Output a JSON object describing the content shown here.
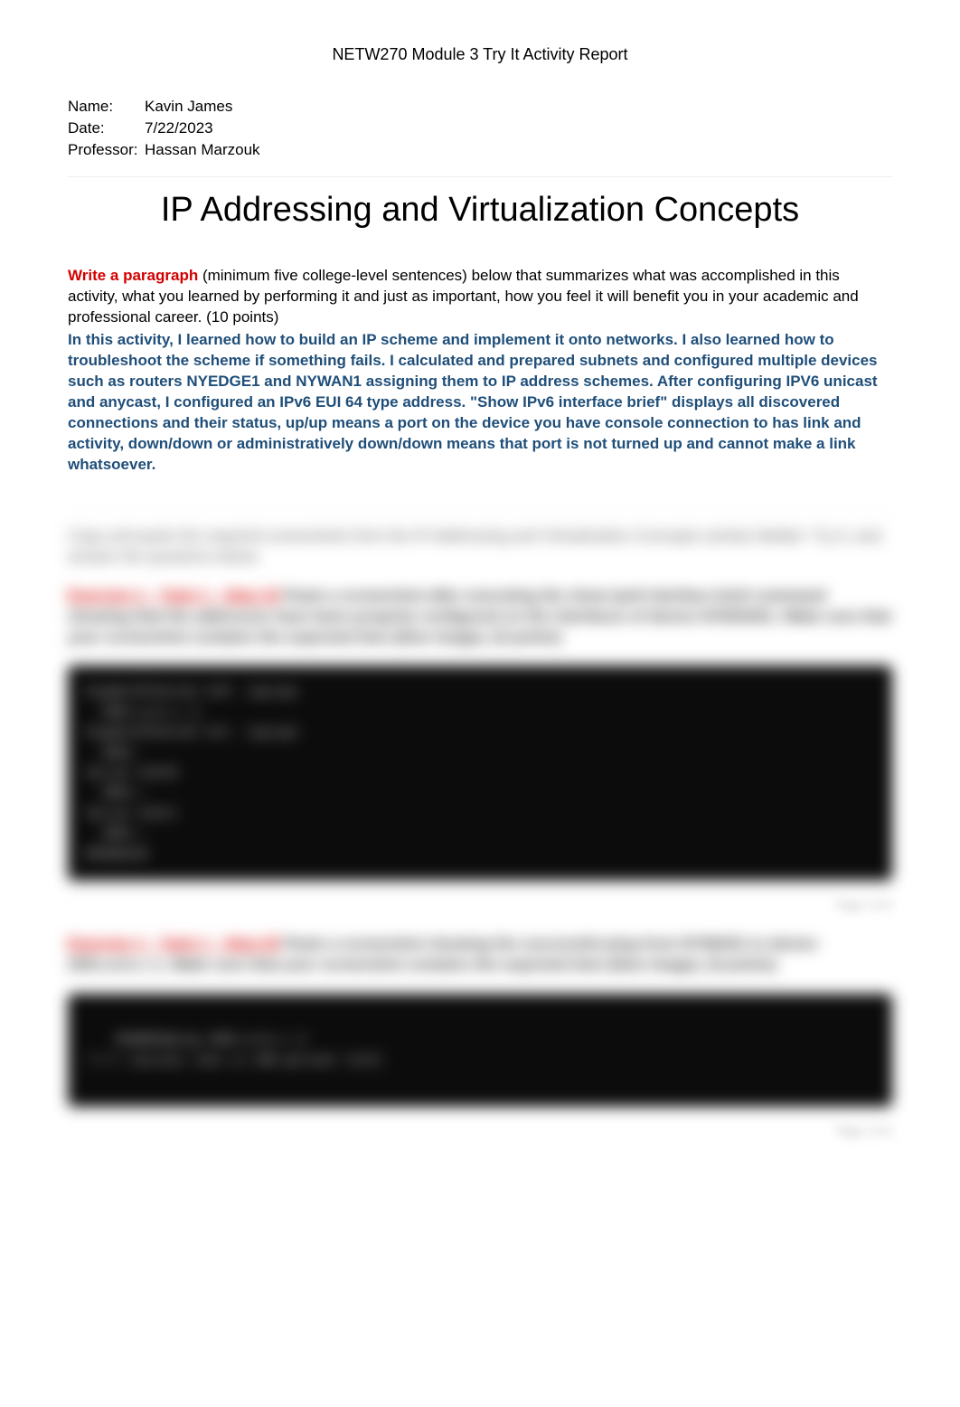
{
  "header": {
    "course_title": "NETW270 Module 3 Try It Activity Report"
  },
  "meta": {
    "name_label": "Name:",
    "name_value": "Kavin James",
    "date_label": "Date:",
    "date_value": "7/22/2023",
    "professor_label": "Professor:",
    "professor_value": "Hassan Marzouk"
  },
  "title": "IP Addressing and Virtualization Concepts",
  "instruction": {
    "prefix": "Write a paragraph",
    "body": " (minimum five college-level sentences) below that summarizes what was accomplished in this activity, what you learned by performing it and just as important, how you feel it will benefit you in your academic and professional career.   (10 points)"
  },
  "response": "In this activity, I learned how to build an IP scheme and implement it onto networks. I also learned how to troubleshoot the scheme if something fails. I calculated and prepared subnets and configured multiple devices such as routers NYEDGE1 and NYWAN1 assigning them to IP address schemes. After configuring IPV6 unicast and anycast, I configured an IPv6 EUI 64 type address. \"Show IPv6 interface brief\" displays all discovered connections and their status, up/up means a port on the device you have console connection to has link and activity, down/down or administratively down/down means that port is not turned up and cannot make a link whatsoever.",
  "blurred": {
    "intro": "Copy and paste the required screenshots from the IP Addressing and Virtualization Concepts activity Netlab+ Try It, and answer the questions below.",
    "q1_red": "Exercise 1 – Task 1 – Step 15",
    "q1_body": "Paste a screenshot after executing the show ipv6 interface brief command showing that the addresses have been properly configured on the interfaces of device NYEDGE1. Make sure that your screenshot contains the expected item (blue image).    (5 points)",
    "q2_red": "Exercise 1 – Task 1 – Step 25",
    "q2_body": "Paste a screenshot showing the successful ping from NYWAN1 to device 2001:a:b:c::1. Make sure that your screenshot contains the expected item (blue image).    (5 points)",
    "terminal1": "GigabitEthernet 0/0  [up/up]\n  2001:a:b:c::1\nGigabitEthernet 0/1  [up/up]\n  2001:\nSerial 0/0/0\n  2001::\nSerial 0/0/1\n  2001::\nNYEDGE1#",
    "terminal2": "NYWAN1#ping 2001:a:b:c::1\n!!!!! Success rate is 100 percent (5/5)",
    "page_indicator": "Page 1 of 4"
  }
}
